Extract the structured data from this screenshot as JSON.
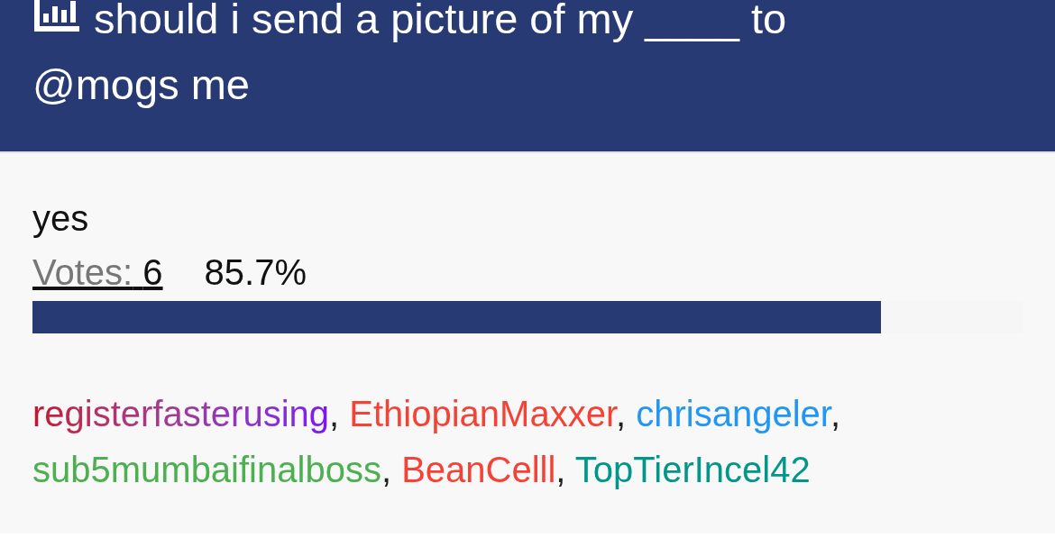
{
  "poll": {
    "title": "should i send a picture of my ____ to @mogs me"
  },
  "options": [
    {
      "label": "yes",
      "votes_label": "Votes:",
      "votes": "6",
      "percent": "85.7%",
      "level": 0.857,
      "voters": [
        {
          "name": "registerfasterusing",
          "kind": "gradient",
          "separator": ","
        },
        {
          "name": "EthiopianMaxxer",
          "kind": "plain",
          "color": "#f44336",
          "separator": ","
        },
        {
          "name": "chrisangeler",
          "kind": "plain",
          "color": "#2196f3",
          "separator": ","
        },
        {
          "name": "sub5mumbaifinalboss",
          "kind": "plain",
          "color": "#4caf50",
          "separator": ","
        },
        {
          "name": "BeanCelll",
          "kind": "plain",
          "color": "#f44336",
          "separator": ","
        },
        {
          "name": "TopTierIncel42",
          "kind": "plain",
          "color": "#009688"
        }
      ]
    }
  ]
}
